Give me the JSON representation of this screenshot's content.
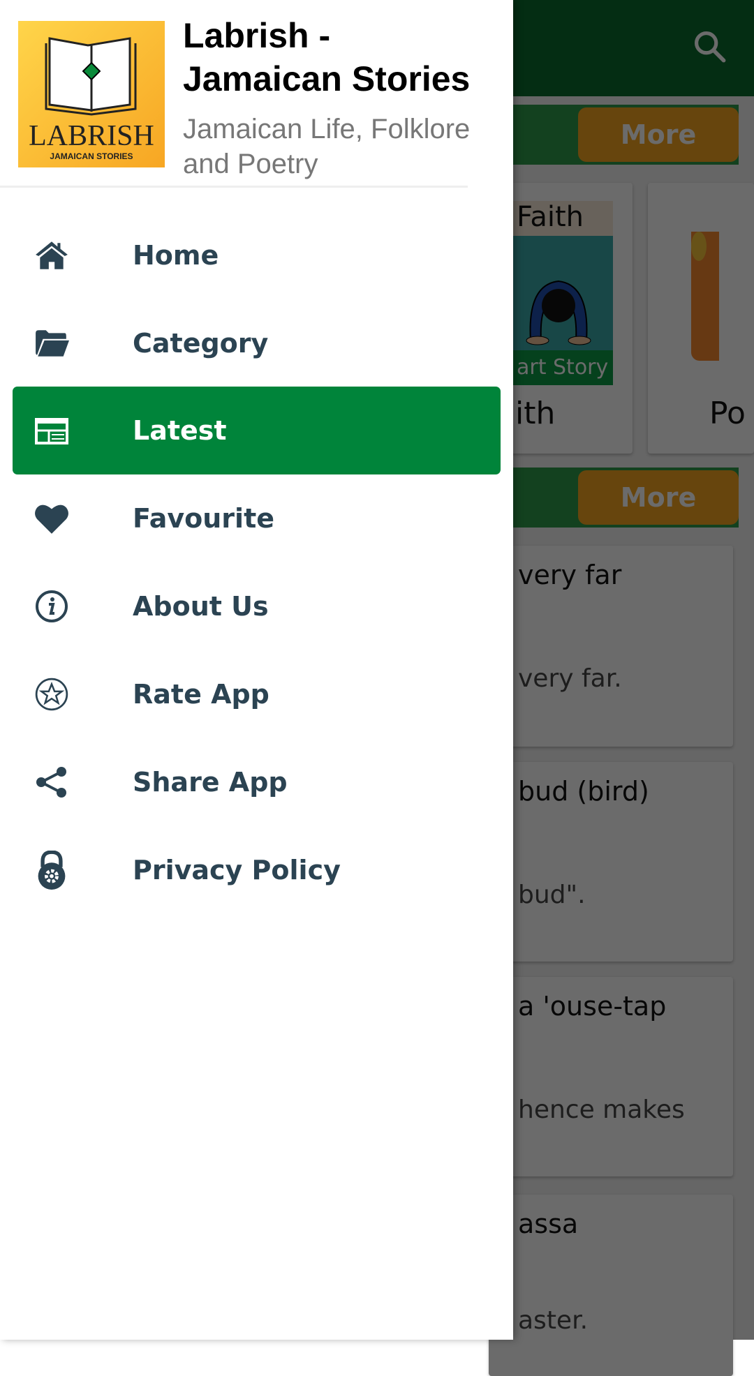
{
  "app": {
    "title_line1": "Labrish -",
    "title_line2": "Jamaican Stories",
    "subtitle_line1": "Jamaican Life, Folklore",
    "subtitle_line2": "and Poetry",
    "logo_text": "LABRISH",
    "logo_subtext": "JAMAICAN STORIES"
  },
  "colors": {
    "accent": "#00843a",
    "text": "#2b4352",
    "toolbar": "#0a6a2e",
    "more_button": "#f6a41e"
  },
  "menu": [
    {
      "label": "Home",
      "icon": "home-icon"
    },
    {
      "label": "Category",
      "icon": "folder-icon"
    },
    {
      "label": "Latest",
      "icon": "newspaper-icon",
      "active": true
    },
    {
      "label": "Favourite",
      "icon": "heart-icon"
    },
    {
      "label": "About Us",
      "icon": "info-icon"
    },
    {
      "label": "Rate App",
      "icon": "star-icon"
    },
    {
      "label": "Share App",
      "icon": "share-icon"
    },
    {
      "label": "Privacy Policy",
      "icon": "lock-icon"
    }
  ],
  "background": {
    "more_label": "More",
    "categories": [
      {
        "label": "ith",
        "image_top": "Faith",
        "image_bottom": "art Story"
      },
      {
        "label": "Po"
      }
    ],
    "list": [
      {
        "title": "very far",
        "desc": "very far."
      },
      {
        "title": "bud (bird)",
        "desc": "bud\"."
      },
      {
        "title": "a 'ouse-tap",
        "desc": "hence makes"
      },
      {
        "title": "assa",
        "desc": "aster."
      }
    ]
  }
}
